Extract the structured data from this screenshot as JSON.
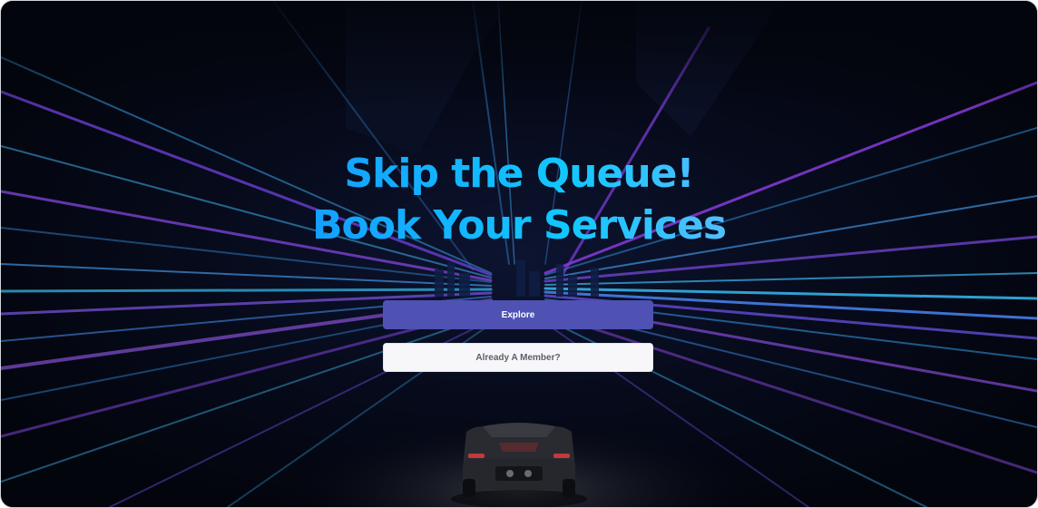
{
  "hero": {
    "headline_line1": "Skip the Queue!",
    "headline_line2": "Book Your Services",
    "image_description": "car-driving-through-light-streak-tunnel"
  },
  "buttons": {
    "explore_label": "Explore",
    "member_label": "Already A Member?"
  },
  "colors": {
    "background": "#060a1a",
    "primary_button": "#4f51b3",
    "secondary_button": "#f7f7f9",
    "gradient_start": "#1f6bff",
    "gradient_mid": "#12c8ff",
    "gradient_end": "#e7b3ff"
  }
}
